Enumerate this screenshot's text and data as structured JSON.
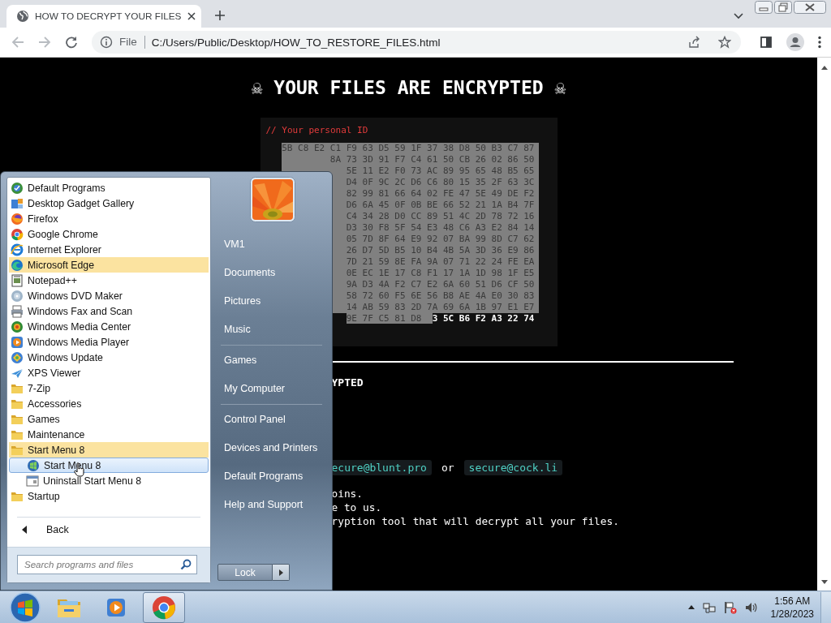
{
  "browser": {
    "tab": {
      "title": "HOW TO DECRYPT YOUR FILES",
      "selected": true
    },
    "address": {
      "scheme": "File",
      "url": "C:/Users/Public/Desktop/HOW_TO_RESTORE_FILES.html"
    }
  },
  "page": {
    "heading": "☠ YOUR FILES ARE ENCRYPTED ☠",
    "id_label": "// Your personal ID",
    "id_rows": [
      {
        "segments": [
          {
            "text": "5B C8 E2 C1 F9 63 D5 59 1F 37 38 D8 50 B3 C7 87",
            "selected": true
          }
        ]
      },
      {
        "segments": [
          {
            "text": "8A 73 3D 91 F7 C4 61 50 CB 26 02 86 50",
            "selected": true
          }
        ]
      },
      {
        "segments": [
          {
            "text": "5E 11 E2 F0 73 AC 89 95 65 48 B5 65",
            "selected": true
          }
        ]
      },
      {
        "segments": [
          {
            "text": "D4 0F 9C 2C D6 C6 80 15 35 2F 63 3C",
            "selected": true
          }
        ]
      },
      {
        "segments": [
          {
            "text": "82 99 81 66 64 02 FE 47 5E 49 DE F2",
            "selected": true
          }
        ]
      },
      {
        "segments": [
          {
            "text": "D6 6A 45 0F 0B BE 66 52 21 1A B4 7F",
            "selected": true
          }
        ]
      },
      {
        "segments": [
          {
            "text": "C4 34 28 D0 CC 89 51 4C 2D 78 72 16",
            "selected": true
          }
        ]
      },
      {
        "segments": [
          {
            "text": "D3 30 F8 5F 54 E3 48 C6 A3 E2 84 14",
            "selected": true
          }
        ]
      },
      {
        "segments": [
          {
            "text": "05 7D 8F 64 E9 92 07 BA 99 8D C7 62",
            "selected": true
          }
        ]
      },
      {
        "segments": [
          {
            "text": "26 D7 5D B5 10 B4 4B 5A 3D 36 E9 86",
            "selected": true
          }
        ]
      },
      {
        "segments": [
          {
            "text": "7D 21 59 8E FA 9A 07 71 22 24 FE EA",
            "selected": true
          }
        ]
      },
      {
        "segments": [
          {
            "text": "0E EC 1E 17 C8 F1 17 1A 1D 98 1F E5",
            "selected": true
          }
        ]
      },
      {
        "segments": [
          {
            "text": "9A D3 4A F2 C7 E2 6A 60 51 D6 CF 50",
            "selected": true
          }
        ]
      },
      {
        "segments": [
          {
            "text": "58 72 60 F5 6E 56 B8 AE 4A E0 30 83",
            "selected": true
          }
        ]
      },
      {
        "segments": [
          {
            "text": "14 AB 59 83 2D 7A 69 6A 1B 97 E1 E7",
            "selected": true
          }
        ]
      },
      {
        "segments": [
          {
            "text": "9E 7F C5 81 D8",
            "selected": true
          },
          {
            "text": "3 5C B6 F2 A3 22 74",
            "selected": false
          }
        ]
      }
    ],
    "heading_fragment": "YPTED",
    "contact": [
      {
        "kind": "code",
        "text": "ecure@blunt.pro"
      },
      {
        "kind": "plain",
        "text": "or"
      },
      {
        "kind": "code",
        "text": "secure@cock.li"
      }
    ],
    "lines": [
      "oins.",
      "e to us.",
      "ryption tool that will decrypt all your files."
    ]
  },
  "start_menu": {
    "programs": [
      {
        "label": "Default Programs",
        "kind": "app",
        "highlighted": false,
        "selected": false
      },
      {
        "label": "Desktop Gadget Gallery",
        "kind": "app",
        "highlighted": false,
        "selected": false
      },
      {
        "label": "Firefox",
        "kind": "app",
        "highlighted": false,
        "selected": false
      },
      {
        "label": "Google Chrome",
        "kind": "app",
        "highlighted": false,
        "selected": false
      },
      {
        "label": "Internet Explorer",
        "kind": "app",
        "highlighted": false,
        "selected": false
      },
      {
        "label": "Microsoft Edge",
        "kind": "app",
        "highlighted": true,
        "selected": false
      },
      {
        "label": "Notepad++",
        "kind": "app",
        "highlighted": false,
        "selected": false
      },
      {
        "label": "Windows DVD Maker",
        "kind": "app",
        "highlighted": false,
        "selected": false
      },
      {
        "label": "Windows Fax and Scan",
        "kind": "app",
        "highlighted": false,
        "selected": false
      },
      {
        "label": "Windows Media Center",
        "kind": "app",
        "highlighted": false,
        "selected": false
      },
      {
        "label": "Windows Media Player",
        "kind": "app",
        "highlighted": false,
        "selected": false
      },
      {
        "label": "Windows Update",
        "kind": "app",
        "highlighted": false,
        "selected": false
      },
      {
        "label": "XPS Viewer",
        "kind": "app",
        "highlighted": false,
        "selected": false
      },
      {
        "label": "7-Zip",
        "kind": "folder",
        "highlighted": false,
        "selected": false
      },
      {
        "label": "Accessories",
        "kind": "folder",
        "highlighted": false,
        "selected": false
      },
      {
        "label": "Games",
        "kind": "folder",
        "highlighted": false,
        "selected": false
      },
      {
        "label": "Maintenance",
        "kind": "folder",
        "highlighted": false,
        "selected": false
      },
      {
        "label": "Start Menu 8",
        "kind": "folder",
        "highlighted": true,
        "selected": false,
        "children": [
          {
            "label": "Start Menu 8",
            "kind": "app",
            "highlighted": false,
            "selected": true
          },
          {
            "label": "Uninstall Start Menu 8",
            "kind": "app",
            "highlighted": false,
            "selected": false
          }
        ]
      },
      {
        "label": "Startup",
        "kind": "folder",
        "highlighted": false,
        "selected": false
      }
    ],
    "back": "Back",
    "search": {
      "placeholder": "Search programs and files"
    },
    "places": [
      [
        "VM1",
        "Documents",
        "Pictures",
        "Music"
      ],
      [
        "Games",
        "My Computer"
      ],
      [
        "Control Panel",
        "Devices and Printers",
        "Default Programs",
        "Help and Support"
      ]
    ],
    "lock": "Lock"
  },
  "taskbar": {
    "buttons": [
      {
        "kind": "start",
        "active": false
      },
      {
        "kind": "explorer",
        "active": false
      },
      {
        "kind": "media",
        "active": false
      },
      {
        "kind": "browser",
        "active": true
      }
    ],
    "time": "1:56 AM",
    "date": "1/28/2023"
  }
}
